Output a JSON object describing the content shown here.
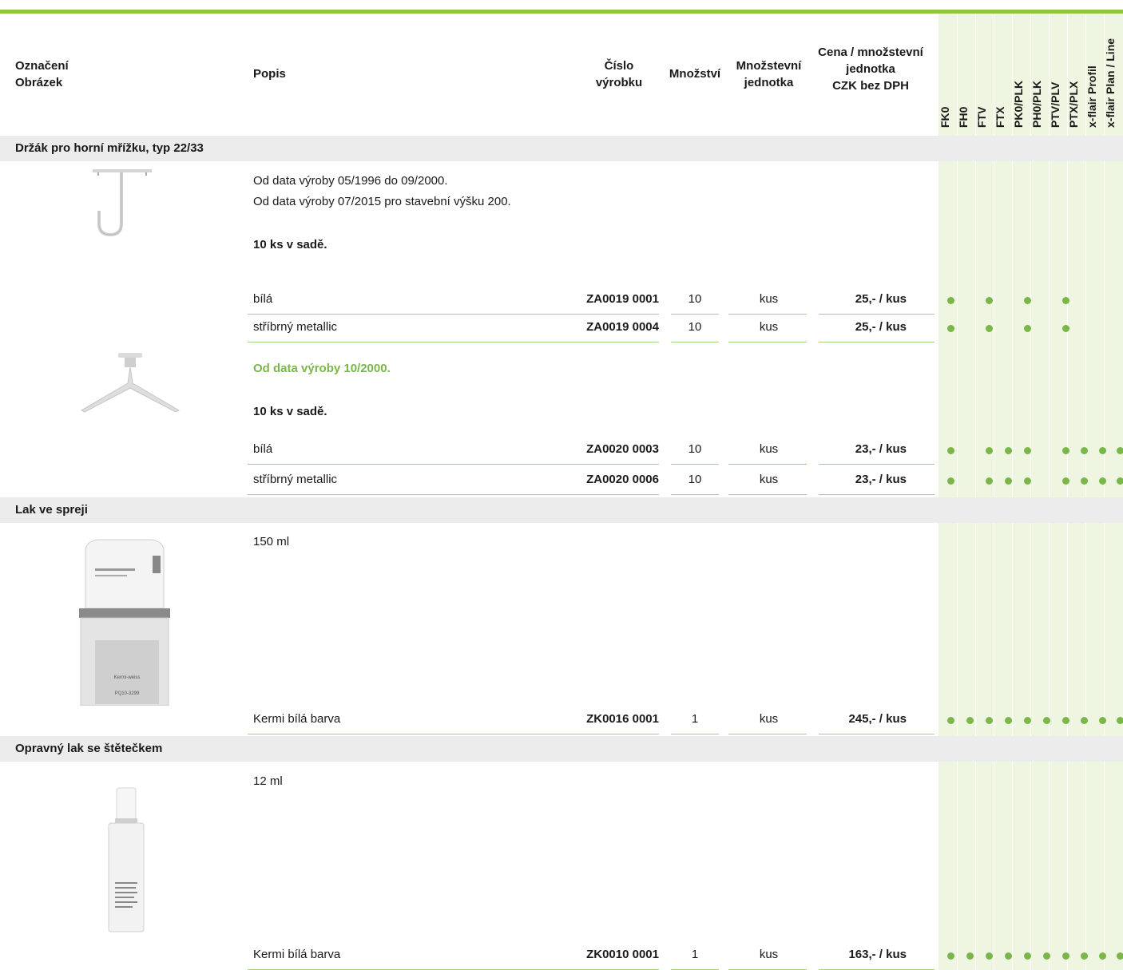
{
  "header": {
    "col_label_1": "Označení",
    "col_label_2": "Obrázek",
    "popis": "Popis",
    "cislo_1": "Číslo",
    "cislo_2": "výrobku",
    "mnozstvi": "Množství",
    "jednotka_1": "Množstevní",
    "jednotka_2": "jednotka",
    "cena_1": "Cena / množstevní",
    "cena_2": "jednotka",
    "cena_3": "CZK bez DPH",
    "compat": [
      "FK0",
      "FH0",
      "FTV",
      "FTX",
      "PK0/PLK",
      "PH0/PLK",
      "PTV/PLV",
      "PTX/PLX",
      "x-flair Profil",
      "x-flair Plan / Line"
    ]
  },
  "sections": {
    "s1": "Držák pro horní mřížku, typ 22/33",
    "s2": "Lak ve spreji",
    "s3": "Opravný lak se štětečkem"
  },
  "notes": {
    "n1a": "Od data výroby 05/1996 do 09/2000.",
    "n1b": "Od data výroby 07/2015 pro stavební výšku 200.",
    "n1c": "10 ks v sadě.",
    "n2a": "Od data výroby 10/2000.",
    "n2b": "10 ks v sadě.",
    "n3": "150 ml",
    "n4": "12 ml"
  },
  "spray_label": {
    "l1": "Kermi-weiss",
    "l2": "PQ10-3299"
  },
  "rows": [
    {
      "desc": "bílá",
      "code": "ZA0019 0001",
      "qty": "10",
      "unit": "kus",
      "price": "25,- / kus",
      "compat": [
        1,
        0,
        1,
        0,
        1,
        0,
        1,
        0,
        0,
        0
      ]
    },
    {
      "desc": "stříbrný metallic",
      "code": "ZA0019 0004",
      "qty": "10",
      "unit": "kus",
      "price": "25,- / kus",
      "compat": [
        1,
        0,
        1,
        0,
        1,
        0,
        1,
        0,
        0,
        0
      ]
    },
    {
      "desc": "bílá",
      "code": "ZA0020 0003",
      "qty": "10",
      "unit": "kus",
      "price": "23,- / kus",
      "compat": [
        1,
        0,
        1,
        1,
        1,
        0,
        1,
        1,
        1,
        1
      ]
    },
    {
      "desc": "stříbrný metallic",
      "code": "ZA0020 0006",
      "qty": "10",
      "unit": "kus",
      "price": "23,- / kus",
      "compat": [
        1,
        0,
        1,
        1,
        1,
        0,
        1,
        1,
        1,
        1
      ]
    },
    {
      "desc": "Kermi bílá barva",
      "code": "ZK0016 0001",
      "qty": "1",
      "unit": "kus",
      "price": "245,- / kus",
      "compat": [
        1,
        1,
        1,
        1,
        1,
        1,
        1,
        1,
        1,
        1
      ]
    },
    {
      "desc": "Kermi bílá barva",
      "code": "ZK0010 0001",
      "qty": "1",
      "unit": "kus",
      "price": "163,- / kus",
      "compat": [
        1,
        1,
        1,
        1,
        1,
        1,
        1,
        1,
        1,
        1
      ]
    }
  ],
  "colors": {
    "accent": "#7ab648",
    "compat_bg": "#eef5e0",
    "section_bg": "#ececec"
  }
}
